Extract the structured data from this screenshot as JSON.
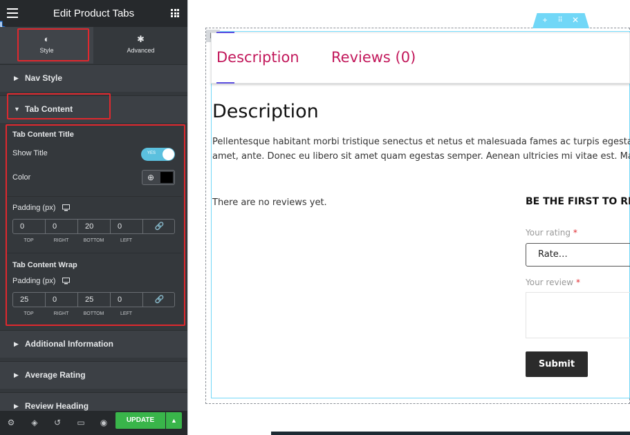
{
  "panel": {
    "title": "Edit Product Tabs",
    "tabs": [
      {
        "label": "Style",
        "icon": "contrast-icon",
        "active": true
      },
      {
        "label": "Advanced",
        "icon": "gear-icon",
        "active": false
      }
    ],
    "sections": {
      "nav_style": "Nav Style",
      "tab_content": "Tab Content",
      "additional_information": "Additional Information",
      "average_rating": "Average Rating",
      "review_heading": "Review Heading"
    },
    "tab_content": {
      "title_heading": "Tab Content Title",
      "show_title_label": "Show Title",
      "show_title_toggle": "YES",
      "color_label": "Color",
      "color_value": "#000000",
      "padding_label": "Padding (px)",
      "padding_title": {
        "top": "0",
        "right": "0",
        "bottom": "20",
        "left": "0"
      },
      "wrap_heading": "Tab Content Wrap",
      "wrap_padding_label": "Padding (px)",
      "padding_wrap": {
        "top": "25",
        "right": "0",
        "bottom": "25",
        "left": "0"
      },
      "dim_labels": {
        "top": "TOP",
        "right": "RIGHT",
        "bottom": "BOTTOM",
        "left": "LEFT"
      }
    },
    "footer": {
      "update_label": "UPDATE"
    }
  },
  "preview": {
    "tabs": [
      "Description",
      "Reviews (0)"
    ],
    "content_heading": "Description",
    "paragraph_line1": "Pellentesque habitant morbi tristique senectus et netus et malesuada fames ac turpis egestas. V",
    "paragraph_line2": "amet, ante. Donec eu libero sit amet quam egestas semper. Aenean ultricies mi vitae est. Mauris",
    "no_reviews": "There are no reviews yet.",
    "be_first": "BE THE FIRST TO RE",
    "rating_label": "Your rating",
    "rating_placeholder": "Rate…",
    "review_label": "Your review",
    "required_mark": "*",
    "submit_label": "Submit"
  },
  "colors": {
    "accent_pink": "#c2185b",
    "update_green": "#39b54a",
    "highlight_red": "#e0282e",
    "toolbar_blue": "#71d7f7"
  }
}
